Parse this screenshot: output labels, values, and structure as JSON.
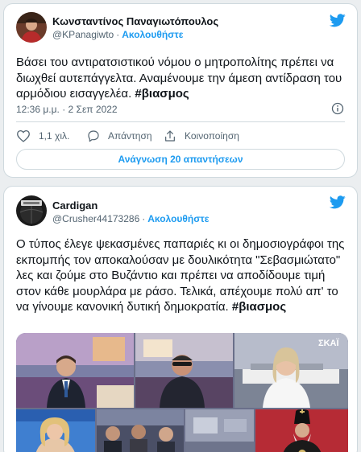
{
  "tweets": [
    {
      "author": "Κωνσταντίνος Παναγιωτόπουλος",
      "handle": "@KPanagiwto",
      "dot": "·",
      "follow": "Ακολουθήστε",
      "text": "Βάσει του αντιρατσιστικού νόμου ο μητροπολίτης πρέπει να διωχθεί αυτεπάγγελτα. Αναμένουμε την άμεση αντίδραση του αρμόδιου εισαγγελέα.",
      "hashtag": "#βιασμος",
      "timestamp": "12:36 μ.μ. · 2 Σεπ 2022",
      "likes": "1,1 χιλ.",
      "reply_label": "Απάντηση",
      "share_label": "Κοινοποίηση",
      "read_replies": "Ανάγνωση 20 απαντήσεων"
    },
    {
      "author": "Cardigan",
      "handle": "@Crusher44173286",
      "dot": "·",
      "follow": "Ακολουθήστε",
      "text": "Ο τύπος έλεγε ψεκασμένες παπαριές κι οι δημοσιογράφοι της εκπομπής τον αποκαλούσαν με δουλικότητα \"Σεβασμιώτατο\" λες και ζούμε στο Βυζάντιο και πρέπει να αποδίδουμε τιμή στον κάθε μουρλάρα με ράσο. Τελικά, απέχουμε πολύ απ' το να γίνουμε κανονική δυτική δημοκρατία.",
      "hashtag": "#βιασμος",
      "media_logo": "ΣΚΑΪ"
    }
  ],
  "colors": {
    "accent": "#1d9bf0",
    "like_red": "#f91880",
    "muted": "#536471"
  },
  "icons": [
    "twitter-bird-icon",
    "info-icon",
    "heart-icon",
    "reply-icon",
    "share-icon"
  ]
}
